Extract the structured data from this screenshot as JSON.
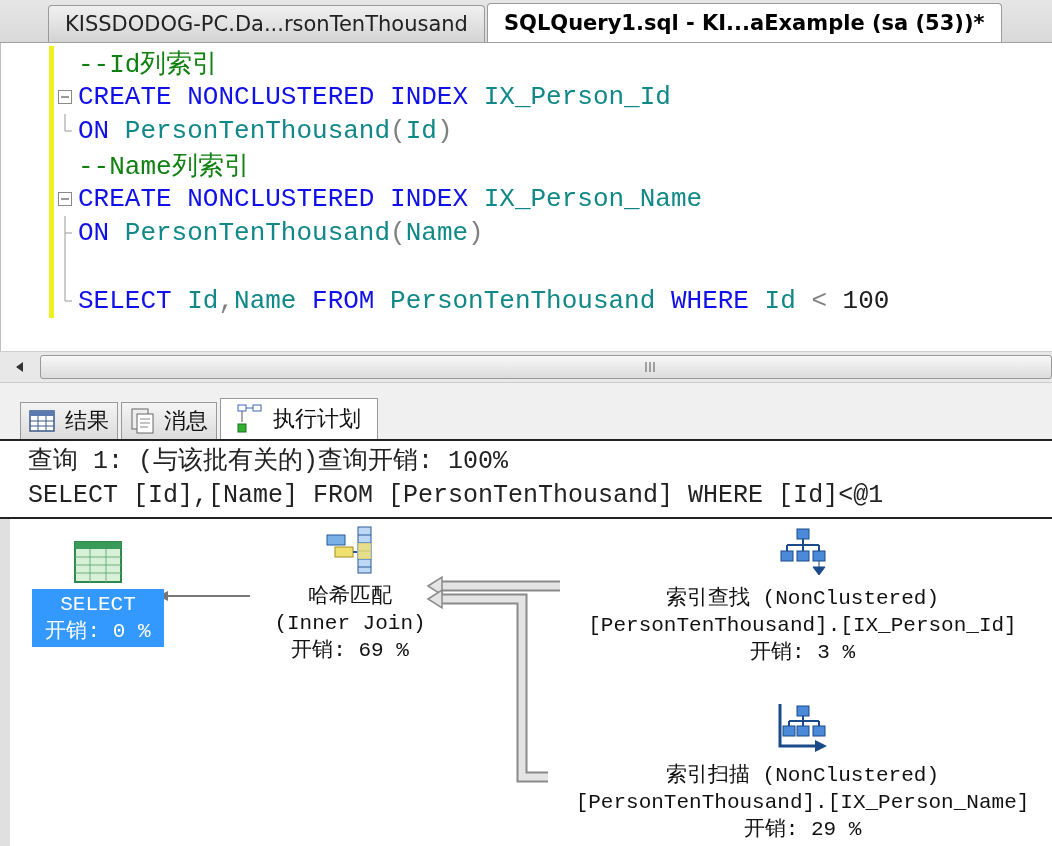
{
  "document_tabs": [
    {
      "label": "KISSDODOG-PC.Da...rsonTenThousand",
      "selected": false
    },
    {
      "label": "SQLQuery1.sql - KI...aExample (sa (53))*",
      "selected": true
    }
  ],
  "editor": {
    "lines": [
      {
        "changed": true,
        "tokens": [
          {
            "kind": "comment",
            "text": "--Id列索引"
          }
        ]
      },
      {
        "kind": "start",
        "changed": true,
        "tokens": [
          {
            "kind": "keyword",
            "text": "CREATE NONCLUSTERED INDEX "
          },
          {
            "kind": "identifier",
            "text": "IX_Person_Id"
          }
        ]
      },
      {
        "kind": "end",
        "changed": true,
        "tokens": [
          {
            "kind": "keyword",
            "text": "ON "
          },
          {
            "kind": "identifier",
            "text": "PersonTenThousand"
          },
          {
            "kind": "operator",
            "text": "("
          },
          {
            "kind": "identifier",
            "text": "Id"
          },
          {
            "kind": "operator",
            "text": ")"
          }
        ]
      },
      {
        "changed": true,
        "tokens": [
          {
            "kind": "comment",
            "text": "--Name列索引"
          }
        ]
      },
      {
        "kind": "start",
        "changed": true,
        "tokens": [
          {
            "kind": "keyword",
            "text": "CREATE NONCLUSTERED INDEX "
          },
          {
            "kind": "identifier",
            "text": "IX_Person_Name"
          }
        ]
      },
      {
        "kind": "branch",
        "changed": true,
        "tokens": [
          {
            "kind": "keyword",
            "text": "ON "
          },
          {
            "kind": "identifier",
            "text": "PersonTenThousand"
          },
          {
            "kind": "operator",
            "text": "("
          },
          {
            "kind": "identifier",
            "text": "Name"
          },
          {
            "kind": "operator",
            "text": ")"
          }
        ]
      },
      {
        "kind": "line",
        "changed": true
      },
      {
        "kind": "end",
        "changed": true,
        "tokens": [
          {
            "kind": "keyword",
            "text": "SELECT "
          },
          {
            "kind": "identifier",
            "text": "Id"
          },
          {
            "kind": "operator",
            "text": ","
          },
          {
            "kind": "identifier",
            "text": "Name "
          },
          {
            "kind": "keyword",
            "text": "FROM "
          },
          {
            "kind": "identifier",
            "text": "PersonTenThousand "
          },
          {
            "kind": "keyword",
            "text": "WHERE "
          },
          {
            "kind": "identifier",
            "text": "Id "
          },
          {
            "kind": "operator",
            "text": "< "
          },
          {
            "kind": "plain",
            "text": "100"
          }
        ]
      }
    ]
  },
  "result_tabs": [
    {
      "label": "结果",
      "kind": "grid",
      "selected": false
    },
    {
      "label": "消息",
      "kind": "messages",
      "selected": false
    },
    {
      "label": "执行计划",
      "kind": "plan",
      "selected": true
    }
  ],
  "plan_header": [
    "查询 1: (与该批有关的)查询开销: 100%",
    "SELECT [Id],[Name] FROM [PersonTenThousand] WHERE [Id]<@1"
  ],
  "plan_nodes": [
    {
      "kind": "select",
      "selected": true,
      "lines": [
        "SELECT",
        "开销: 0 %"
      ]
    },
    {
      "kind": "hash-match",
      "selected": false,
      "lines": [
        "哈希匹配",
        "(Inner Join)",
        "开销: 69 %"
      ]
    },
    {
      "kind": "index-seek",
      "selected": false,
      "lines": [
        "索引查找 (NonClustered)",
        "[PersonTenThousand].[IX_Person_Id]",
        "开销: 3 %"
      ]
    },
    {
      "kind": "index-scan",
      "selected": false,
      "lines": [
        "索引扫描 (NonClustered)",
        "[PersonTenThousand].[IX_Person_Name]",
        "开销: 29 %"
      ]
    }
  ]
}
